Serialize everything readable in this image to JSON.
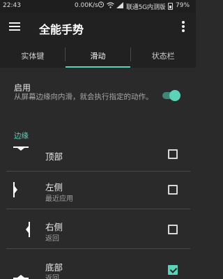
{
  "status_bar": {
    "time": "22:43",
    "net_speed": "0.00K/s",
    "carrier": "联通5G内测版",
    "battery_pct": "79%",
    "icons": [
      "alarm-icon",
      "wifi-icon",
      "signal-icon",
      "battery-icon"
    ]
  },
  "app_bar": {
    "title": "全能手势",
    "menu_icon": "hamburger-menu-icon",
    "more_icon": "more-vert-icon"
  },
  "tabs": [
    {
      "label": "实体键",
      "active": false
    },
    {
      "label": "滑动",
      "active": true
    },
    {
      "label": "状态栏",
      "active": false
    }
  ],
  "enable": {
    "title": "启用",
    "description": "从屏幕边缘向内滑，就会执行指定的动作。",
    "toggle_on": true
  },
  "edge_section": {
    "label": "边缘",
    "items": [
      {
        "name": "顶部",
        "sub": "",
        "checked": false,
        "graphic": "top-edge-icon"
      },
      {
        "name": "左侧",
        "sub": "最近应用",
        "checked": false,
        "graphic": "left-edge-icon"
      },
      {
        "name": "右侧",
        "sub": "返回",
        "checked": false,
        "graphic": "right-edge-icon"
      },
      {
        "name": "底部",
        "sub": "返回",
        "checked": true,
        "graphic": "bottom-edge-icon"
      }
    ]
  },
  "colors": {
    "accent": "#5ad3b8",
    "background": "#2a2a2a",
    "app_bar": "#212121"
  }
}
